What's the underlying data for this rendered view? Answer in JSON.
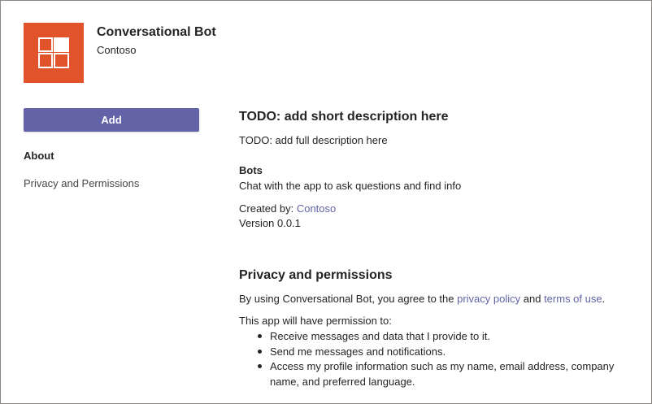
{
  "app": {
    "name": "Conversational Bot",
    "developer": "Contoso",
    "icon": "app-tiles-icon",
    "icon_bg": "#e0532b"
  },
  "sidebar": {
    "add_label": "Add",
    "button_color": "#6264a7",
    "items": [
      {
        "label": "About"
      },
      {
        "label": "Privacy and Permissions"
      }
    ]
  },
  "about": {
    "short_description": "TODO: add short description here",
    "full_description": "TODO: add full description here",
    "bots_title": "Bots",
    "bots_description": "Chat with the app to ask questions and find info",
    "created_by_prefix": "Created by: ",
    "created_by_link": "Contoso",
    "version": "Version 0.0.1"
  },
  "privacy": {
    "title": "Privacy and permissions",
    "text_prefix": "By using Conversational Bot, you agree to the ",
    "privacy_link": "privacy policy",
    "text_mid": " and ",
    "terms_link": "terms of use",
    "text_suffix": ".",
    "permissions_intro": "This app will have permission to:",
    "permissions": [
      "Receive messages and data that I provide to it.",
      "Send me messages and notifications.",
      "Access my profile information such as my name, email address, company name, and preferred language."
    ]
  },
  "link_color": "#6264a7"
}
